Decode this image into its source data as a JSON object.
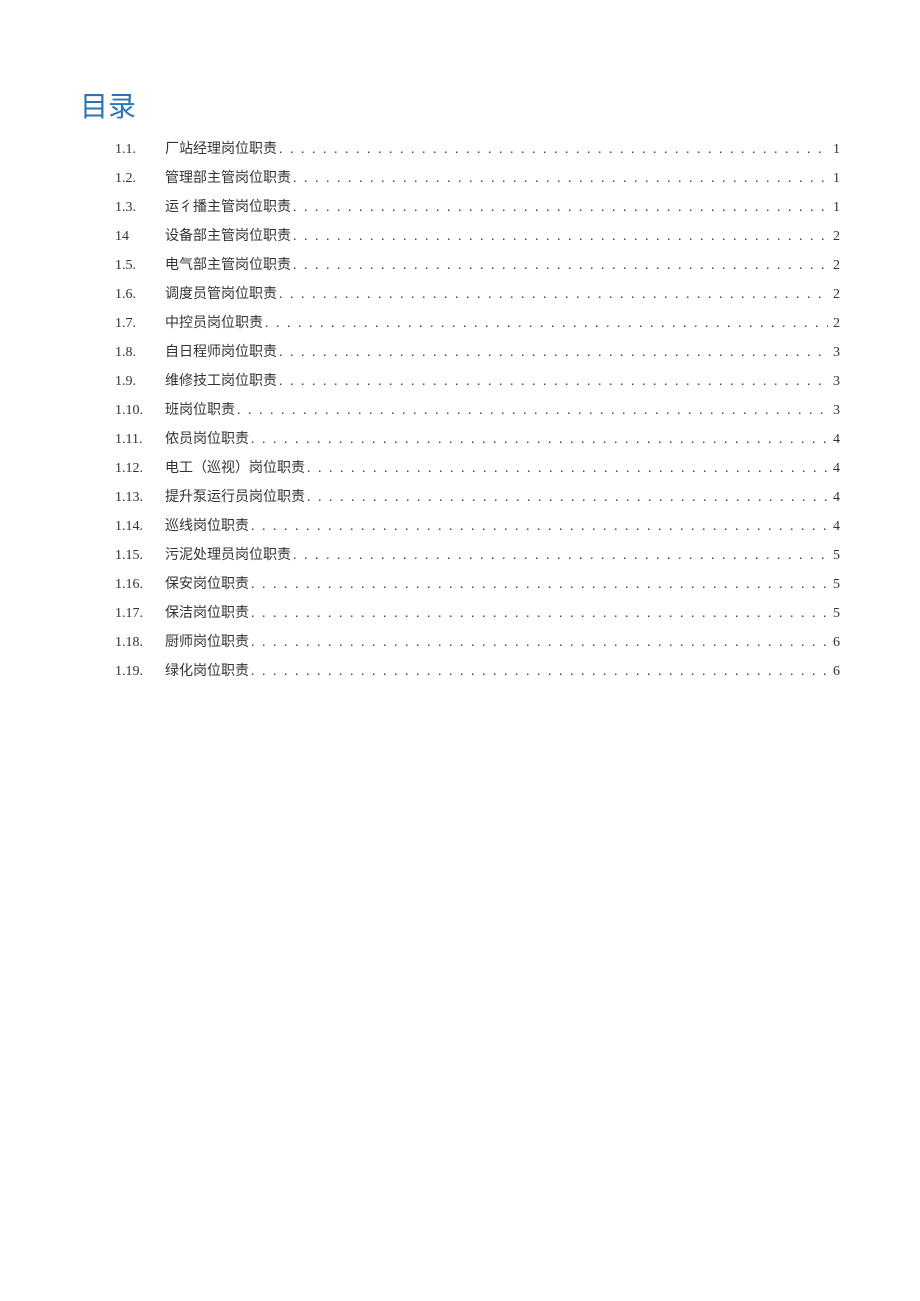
{
  "title": "目录",
  "entries": [
    {
      "number": "1.1.",
      "label": "厂站经理岗位职责",
      "page": "1",
      "trailing_space": true
    },
    {
      "number": "1.2.",
      "label": "管理部主管岗位职责",
      "page": "1",
      "trailing_space": true
    },
    {
      "number": "1.3.",
      "label": "运彳播主管岗位职责",
      "page": "1",
      "trailing_space": true
    },
    {
      "number": "14",
      "label": "设备部主管岗位职责",
      "page": "2",
      "trailing_space": true
    },
    {
      "number": "1.5.",
      "label": "电气部主管岗位职责",
      "page": "2",
      "trailing_space": true
    },
    {
      "number": "1.6.",
      "label": "调度员管岗位职责",
      "page": "2",
      "trailing_space": true
    },
    {
      "number": "1.7.",
      "label": "中控员岗位职责",
      "page": "2",
      "trailing_space": true
    },
    {
      "number": "1.8.",
      "label": "自日程师岗位职责",
      "page": "3",
      "trailing_space": true
    },
    {
      "number": "1.9.",
      "label": "维修技工岗位职责",
      "page": "3",
      "trailing_space": true
    },
    {
      "number": "1.10.",
      "label": "班岗位职责",
      "page": "3",
      "trailing_space": true
    },
    {
      "number": "1.11.",
      "label": "侬员岗位职责",
      "page": "4",
      "trailing_space": false
    },
    {
      "number": "1.12.",
      "label": "电工（巡视）岗位职责",
      "page": "4",
      "trailing_space": false
    },
    {
      "number": "1.13.",
      "label": "提升泵运行员岗位职责",
      "page": "4",
      "trailing_space": false
    },
    {
      "number": "1.14.",
      "label": "巡线岗位职责",
      "page": "4",
      "trailing_space": false
    },
    {
      "number": "1.15.",
      "label": "污泥处理员岗位职责",
      "page": "5",
      "trailing_space": false
    },
    {
      "number": "1.16.",
      "label": "保安岗位职责",
      "page": "5",
      "trailing_space": false
    },
    {
      "number": "1.17.",
      "label": "保洁岗位职责",
      "page": "5",
      "trailing_space": false
    },
    {
      "number": "1.18.",
      "label": "厨师岗位职责",
      "page": "6",
      "trailing_space": false
    },
    {
      "number": "1.19.",
      "label": "绿化岗位职责",
      "page": "6",
      "trailing_space": false
    }
  ]
}
